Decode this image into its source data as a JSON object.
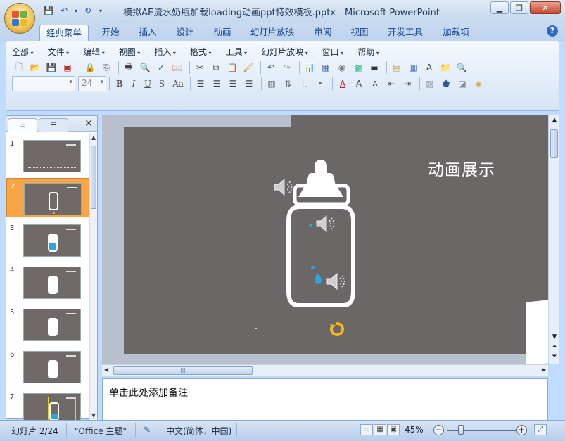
{
  "window": {
    "title": "模拟AE流水奶瓶加载loading动画ppt特效模板.pptx - Microsoft PowerPoint"
  },
  "ribbon_tabs": [
    "经典菜单",
    "开始",
    "插入",
    "设计",
    "动画",
    "幻灯片放映",
    "审阅",
    "视图",
    "开发工具",
    "加载项"
  ],
  "menu": [
    "全部",
    "文件",
    "编辑",
    "视图",
    "插入",
    "格式",
    "工具",
    "幻灯片放映",
    "窗口",
    "帮助"
  ],
  "font_size": "24",
  "format_buttons": [
    "B",
    "I",
    "U",
    "S",
    "Aa"
  ],
  "thumbnails": [
    "1",
    "2",
    "3",
    "4",
    "5",
    "6",
    "7"
  ],
  "slide": {
    "title": "动画展示"
  },
  "notes_placeholder": "单击此处添加备注",
  "status": {
    "slide_info": "幻灯片 2/24",
    "theme": "\"Office 主题\"",
    "language": "中文(简体，中国)",
    "zoom": "45%"
  },
  "colors": {
    "slide_bg": "#6b6766",
    "accent_blue": "#29a8e0",
    "accent_orange": "#f8a547",
    "spinner": "#f2b51c"
  }
}
